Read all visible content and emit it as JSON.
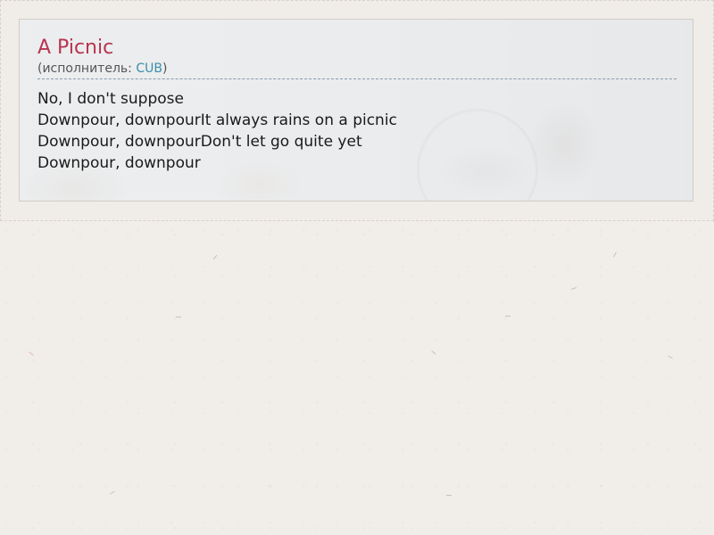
{
  "song": {
    "title": "A Picnic",
    "performer_prefix": "(исполнитель: ",
    "performer_name": "CUB",
    "performer_suffix": ")"
  },
  "lyrics": [
    "No, I don't suppose",
    "Downpour, downpourIt always rains on a picnic",
    "Downpour, downpourDon't let go quite yet",
    "Downpour, downpour"
  ],
  "colors": {
    "title": "#b8344e",
    "performer_link": "#3a8fa8"
  }
}
